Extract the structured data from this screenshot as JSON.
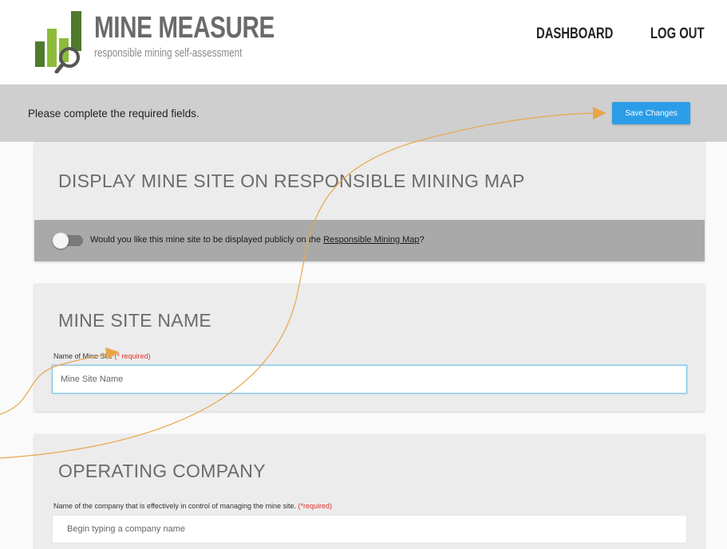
{
  "header": {
    "logo_title": "MINE MEASURE",
    "logo_subtitle": "responsible mining self-assessment",
    "nav": {
      "dashboard": "DASHBOARD",
      "logout": "LOG OUT"
    }
  },
  "notice": {
    "message": "Please complete the required fields.",
    "save_label": "Save Changes"
  },
  "sections": {
    "display_map": {
      "title": "DISPLAY MINE SITE ON RESPONSIBLE MINING MAP",
      "toggle_text": "Would you like this mine site to be displayed publicly on the ",
      "toggle_link": "Responsible Mining Map",
      "toggle_suffix": "?",
      "toggle_on": false
    },
    "site_name": {
      "title": "MINE SITE NAME",
      "label": "Name of Mine Site",
      "required": "(* required)",
      "placeholder": "Mine Site Name"
    },
    "company": {
      "title": "OPERATING COMPANY",
      "label": "Name of the company that is effectively in control of managing the mine site.",
      "required": "(*required)",
      "placeholder": "Begin typing a company name"
    }
  },
  "colors": {
    "accent_blue": "#2b9de8",
    "required_red": "#e0322b",
    "logo_green_dark": "#4f7a2c",
    "logo_green_light": "#8dbb3a",
    "annotation_orange": "#e8a64a"
  },
  "icons": {
    "logo_mark": "bar-chart-magnifier-icon",
    "annotation": "arrow-icon"
  }
}
